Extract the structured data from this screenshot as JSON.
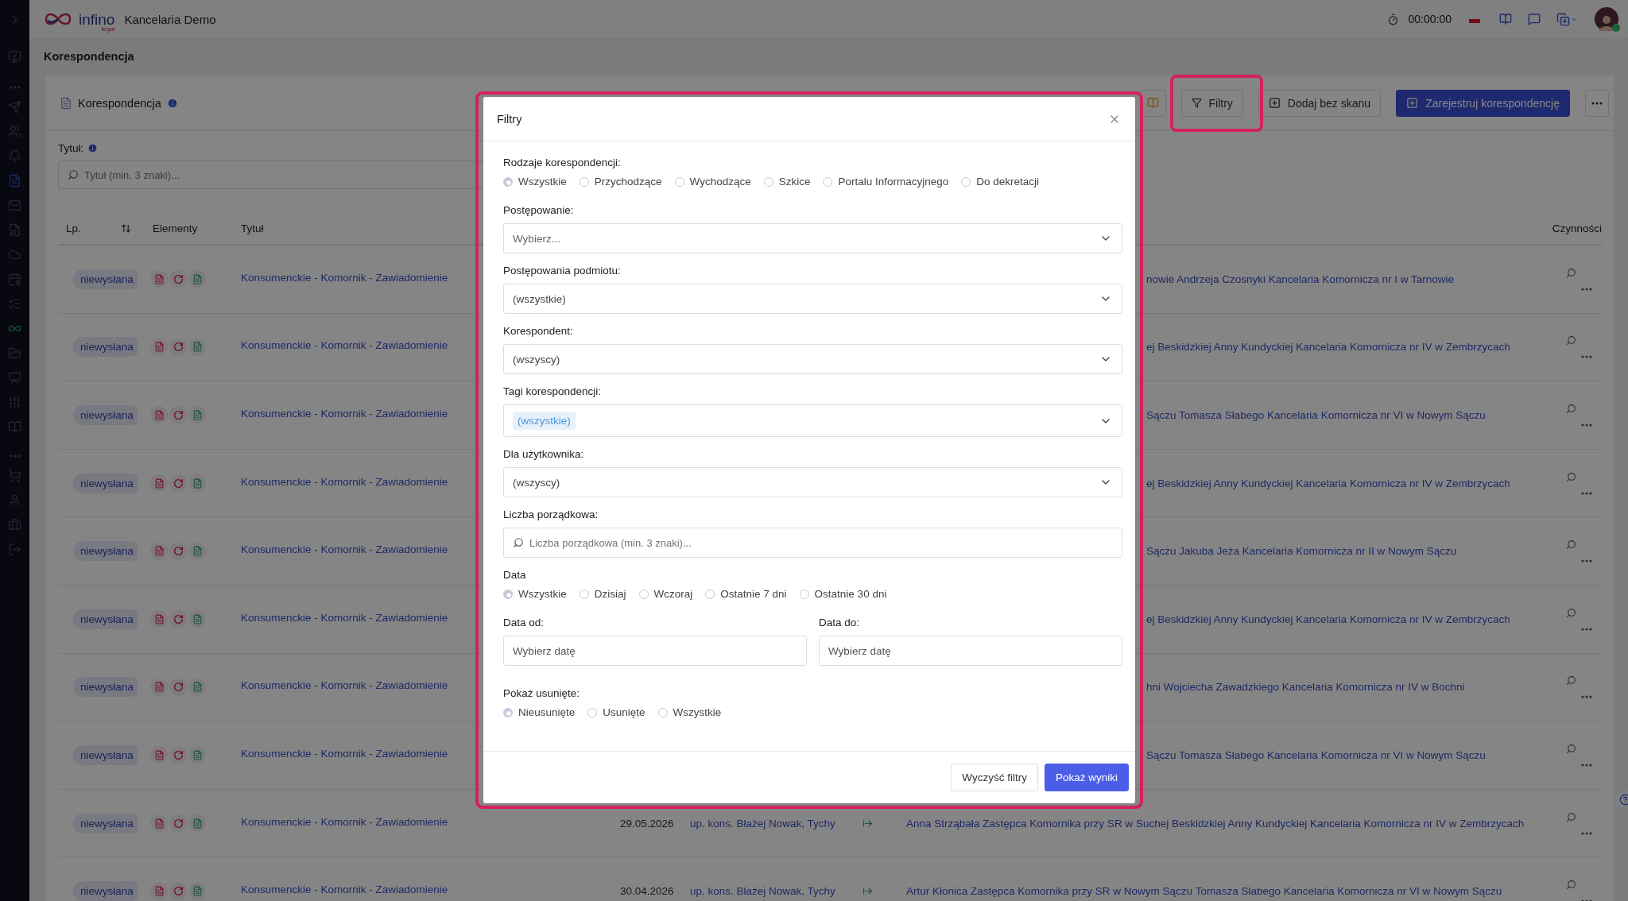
{
  "app": {
    "logo": "infino",
    "logo_sub": "legal",
    "firm": "Kancelaria Demo",
    "timer": "00:00:00"
  },
  "breadcrumb": "Korespondencja",
  "card": {
    "title": "Korespondencja",
    "buttons": [
      {
        "label": "Filtry",
        "kind": "outline",
        "highlighted": true
      },
      {
        "label": "Dodaj bez skanu",
        "kind": "outline",
        "highlighted": false
      },
      {
        "label": "Zarejestruj korespondencję",
        "kind": "primary",
        "highlighted": false
      }
    ]
  },
  "title_filter": {
    "label": "Tytuł:",
    "placeholder": "Tytuł (min. 3 znaki)..."
  },
  "table": {
    "columns": {
      "lp": "Lp.",
      "elements": "Elementy",
      "title": "Tytuł",
      "actions": "Czynności"
    },
    "rows": [
      {
        "status": "niewysłana",
        "title": "Konsumenckie - Komornik - Zawiadomienie",
        "addressee": "nowie Andrzeja Czosnyki Kancelaria Komornicza nr I w Tarnowie"
      },
      {
        "status": "niewysłana",
        "title": "Konsumenckie - Komornik - Zawiadomienie",
        "addressee": "ej Beskidzkiej Anny Kundyckiej Kancelaria Komornicza nr IV w Zembrzycach"
      },
      {
        "status": "niewysłana",
        "title": "Konsumenckie - Komornik - Zawiadomienie",
        "addressee": "Sączu Tomasza Słabego Kancelaria Komornicza nr VI w Nowym Sączu"
      },
      {
        "status": "niewysłana",
        "title": "Konsumenckie - Komornik - Zawiadomienie",
        "addressee": "ej Beskidzkiej Anny Kundyckiej Kancelaria Komornicza nr IV w Zembrzycach"
      },
      {
        "status": "niewysłana",
        "title": "Konsumenckie - Komornik - Zawiadomienie",
        "addressee": "Sączu Jakuba Jeża Kancelaria Komornicza nr II w Nowym Sączu"
      },
      {
        "status": "niewysłana",
        "title": "Konsumenckie - Komornik - Zawiadomienie",
        "addressee": "ej Beskidzkiej Anny Kundyckiej Kancelaria Komornicza nr IV w Zembrzycach"
      },
      {
        "status": "niewysłana",
        "title": "Konsumenckie - Komornik - Zawiadomienie",
        "addressee": "hni Wojciecha Zawadzkiego Kancelaria Komornicza nr IV w Bochni"
      },
      {
        "status": "niewysłana",
        "title": "Konsumenckie - Komornik - Zawiadomienie",
        "addressee": "Sączu Tomasza Słabego Kancelaria Komornicza nr VI w Nowym Sączu"
      },
      {
        "status": "niewysłana",
        "title": "Konsumenckie - Komornik - Zawiadomienie",
        "date": "29.05.2026",
        "correspondent": "up. kons. Błażej Nowak, Tychy",
        "addressee": "Anna Strząbała Zastępca Komornika przy SR w Suchej Beskidzkiej Anny Kundyckiej Kancelaria Komornicza nr IV w Zembrzycach"
      },
      {
        "status": "niewysłana",
        "title": "Konsumenckie - Komornik - Zawiadomienie",
        "date": "30.04.2026",
        "correspondent": "up. kons. Błażej Nowak, Tychy",
        "addressee": "Artur Kłonica Zastępca Komornika przy SR w Nowym Sączu Tomasza Słabego Kancelaria Komornicza nr VI w Nowym Sączu"
      }
    ]
  },
  "modal": {
    "title": "Filtry",
    "highlighted": true,
    "sections": [
      {
        "kind": "radio",
        "label": "Rodzaje korespondencji:",
        "options": [
          {
            "label": "Wszystkie",
            "selected": true
          },
          {
            "label": "Przychodzące",
            "selected": false
          },
          {
            "label": "Wychodzące",
            "selected": false
          },
          {
            "label": "Szkice",
            "selected": false
          },
          {
            "label": "Portalu Informacyjnego",
            "selected": false
          },
          {
            "label": "Do dekretacji",
            "selected": false
          }
        ]
      },
      {
        "kind": "select",
        "label": "Postępowanie:",
        "placeholder": "Wybierz..."
      },
      {
        "kind": "select",
        "label": "Postępowania podmiotu:",
        "value": "(wszystkie)"
      },
      {
        "kind": "select",
        "label": "Korespondent:",
        "value": "(wszyscy)"
      },
      {
        "kind": "tags",
        "label": "Tagi korespondencji:",
        "tags": [
          "(wszystkie)"
        ]
      },
      {
        "kind": "select",
        "label": "Dla użytkownika:",
        "value": "(wszyscy)"
      },
      {
        "kind": "search",
        "label": "Liczba porządkowa:",
        "placeholder": "Liczba porządkowa (min. 3 znaki)..."
      },
      {
        "kind": "radio",
        "label": "Data",
        "options": [
          {
            "label": "Wszystkie",
            "selected": true
          },
          {
            "label": "Dzisiaj",
            "selected": false
          },
          {
            "label": "Wczoraj",
            "selected": false
          },
          {
            "label": "Ostatnie 7 dni",
            "selected": false
          },
          {
            "label": "Ostatnie 30 dni",
            "selected": false
          }
        ]
      },
      {
        "kind": "dates",
        "fields": [
          {
            "label": "Data od:",
            "placeholder": "Wybierz datę"
          },
          {
            "label": "Data do:",
            "placeholder": "Wybierz datę"
          }
        ]
      },
      {
        "kind": "radio",
        "label": "Pokaż usunięte:",
        "options": [
          {
            "label": "Nieusunięte",
            "selected": true
          },
          {
            "label": "Usunięte",
            "selected": false
          },
          {
            "label": "Wszystkie",
            "selected": false
          }
        ]
      }
    ],
    "buttons": [
      {
        "label": "Wyczyść filtry",
        "kind": "secondary"
      },
      {
        "label": "Pokaż wyniki",
        "kind": "primary"
      }
    ]
  }
}
